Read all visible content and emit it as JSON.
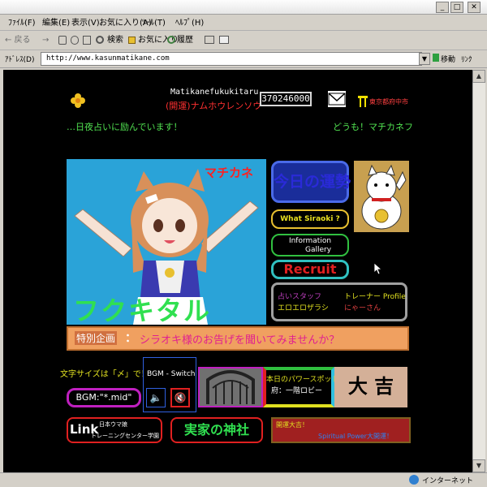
{
  "window": {
    "min_glyph": "_",
    "max_glyph": "□",
    "close_glyph": "✕"
  },
  "menus": [
    "ﾌｧｲﾙ(F)",
    "編集(E)",
    "表示(V)",
    "お気に入り(A)",
    "ﾂｰﾙ(T)",
    "ﾍﾙﾌﾟ(H)"
  ],
  "toolbar": {
    "back": "← 戻る",
    "forward": "→",
    "search": "検索",
    "favorites": "お気に入り",
    "history": "履歴"
  },
  "address": {
    "label": "ｱﾄﾞﾚｽ(D)",
    "url": "http://www.kasunmatikane.com",
    "go": "移動",
    "links": "ﾘﾝｸ"
  },
  "page": {
    "site_name": "Matikanefukukitaru",
    "subtitle": "(開運)ナムホウレンソウ",
    "counter": "370246000",
    "region": "東京都府中市",
    "marquee_left": "…日夜占いに励んでいます！",
    "marquee_right": "どうも！マチカネフ",
    "char_name_top": "マチカネ",
    "char_name_big": "フクキタル",
    "nav": {
      "fortune": "今日の運勢",
      "siraoki": "What Siraoki ?",
      "info_line1": "Information",
      "info_line2": "Gallery",
      "recruit": "Recruit"
    },
    "staff": {
      "col1_line1": "占いスタッフ",
      "col1_line2": "エロエロザラシ",
      "col2_line1": "トレーナー Profile",
      "col2_line2": "にゃーさん"
    },
    "banner": {
      "tag": "特別企画",
      "colon": "：",
      "text": "シラオキ様のお告げを聞いてみませんか？"
    },
    "font_size_note": "文字サイズは「〆」で！",
    "bgm_switch": "BGM - Switch",
    "bgm_label": "BGM:\"*.mid\"",
    "speaker_icon": "🔈",
    "mute_icon": "🔇",
    "power_spot_line1": "本日のパワースポット",
    "power_spot_line2": "府：一階ロビー",
    "daikichi": "大 吉",
    "link_label": "Link",
    "link_sub1": "日本ウマ娘",
    "link_sub2": "トレーニングセンター学園",
    "shrine": "実家の神社",
    "spiritual_line1": "開運大吉！",
    "spiritual_line2": "Spiritual Power大開運！"
  },
  "status": {
    "zone": "インターネット"
  },
  "colors": {
    "bg": "#000000",
    "nav_blue": "#2d4fd8",
    "nav_green": "#28c040",
    "nav_red": "#e02020",
    "banner_orange": "#f0a060",
    "magenta": "#c020c0"
  }
}
